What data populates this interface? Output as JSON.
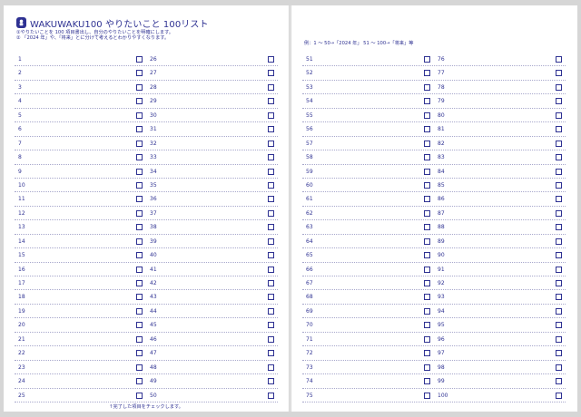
{
  "header": {
    "title": "WAKUWAKU100 やりたいこと 100リスト",
    "note1": "①やりたいことを 100 項目書出し、自分のやりたいことを明確にします。",
    "note2": "② 「2024 年」や、「将来」とに分けて考えるとわかりやすくなります。"
  },
  "example": "例：1 ～ 50→「2024 年」 51 ～ 100→「将来」等",
  "footer": "↑完了した項目をチェックします。",
  "left_rows": [
    [
      "1",
      "26"
    ],
    [
      "2",
      "27"
    ],
    [
      "3",
      "28"
    ],
    [
      "4",
      "29"
    ],
    [
      "5",
      "30"
    ],
    [
      "6",
      "31"
    ],
    [
      "7",
      "32"
    ],
    [
      "8",
      "33"
    ],
    [
      "9",
      "34"
    ],
    [
      "10",
      "35"
    ],
    [
      "11",
      "36"
    ],
    [
      "12",
      "37"
    ],
    [
      "13",
      "38"
    ],
    [
      "14",
      "39"
    ],
    [
      "15",
      "40"
    ],
    [
      "16",
      "41"
    ],
    [
      "17",
      "42"
    ],
    [
      "18",
      "43"
    ],
    [
      "19",
      "44"
    ],
    [
      "20",
      "45"
    ],
    [
      "21",
      "46"
    ],
    [
      "22",
      "47"
    ],
    [
      "23",
      "48"
    ],
    [
      "24",
      "49"
    ],
    [
      "25",
      "50"
    ]
  ],
  "right_rows": [
    [
      "51",
      "76"
    ],
    [
      "52",
      "77"
    ],
    [
      "53",
      "78"
    ],
    [
      "54",
      "79"
    ],
    [
      "55",
      "80"
    ],
    [
      "56",
      "81"
    ],
    [
      "57",
      "82"
    ],
    [
      "58",
      "83"
    ],
    [
      "59",
      "84"
    ],
    [
      "60",
      "85"
    ],
    [
      "61",
      "86"
    ],
    [
      "62",
      "87"
    ],
    [
      "63",
      "88"
    ],
    [
      "64",
      "89"
    ],
    [
      "65",
      "90"
    ],
    [
      "66",
      "91"
    ],
    [
      "67",
      "92"
    ],
    [
      "68",
      "93"
    ],
    [
      "69",
      "94"
    ],
    [
      "70",
      "95"
    ],
    [
      "71",
      "96"
    ],
    [
      "72",
      "97"
    ],
    [
      "73",
      "98"
    ],
    [
      "74",
      "99"
    ],
    [
      "75",
      "100"
    ]
  ]
}
